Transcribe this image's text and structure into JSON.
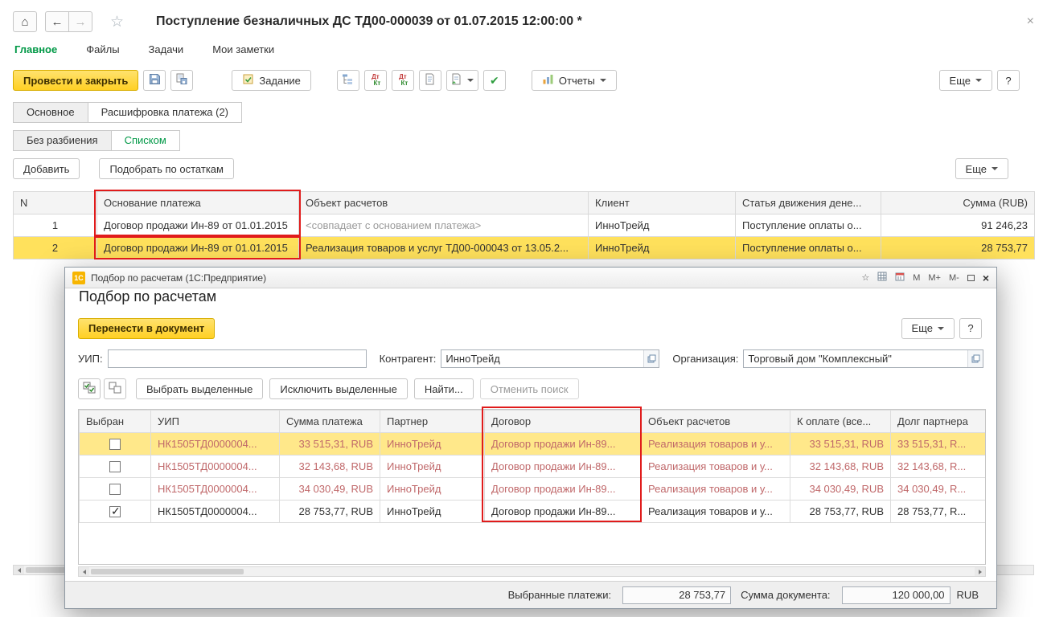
{
  "icons": {
    "home": "⌂",
    "back": "←",
    "forward": "→",
    "favorite": "☆",
    "close": "×",
    "post_check": "✔",
    "dt": "Дт",
    "kt": "Кт",
    "logo_1c": "1С"
  },
  "window": {
    "title": "Поступление безналичных ДС ТД00-000039 от 01.07.2015 12:00:00 *"
  },
  "menu": {
    "items": [
      {
        "label": "Главное"
      },
      {
        "label": "Файлы"
      },
      {
        "label": "Задачи"
      },
      {
        "label": "Мои заметки"
      }
    ]
  },
  "toolbar": {
    "post_and_close": "Провести и закрыть",
    "task": "Задание",
    "reports": "Отчеты",
    "more": "Еще",
    "help": "?"
  },
  "doc_tabs": {
    "main": "Основное",
    "breakdown": "Расшифровка платежа (2)"
  },
  "view_tabs": {
    "no_split": "Без разбиения",
    "as_list": "Списком"
  },
  "list_toolbar": {
    "add": "Добавить",
    "pick_by_balances": "Подобрать по остаткам",
    "more": "Еще"
  },
  "payments_table": {
    "columns": [
      "N",
      "Основание платежа",
      "Объект расчетов",
      "Клиент",
      "Статья движения дене...",
      "Сумма (RUB)"
    ],
    "rows": [
      {
        "n": "1",
        "basis": "Договор продажи Ин-89 от 01.01.2015",
        "settlement_object": "<совпадает с основанием платежа>",
        "client": "ИнноТрейд",
        "cash_flow_item": "Поступление оплаты о...",
        "amount": "91 246,23"
      },
      {
        "n": "2",
        "basis": "Договор продажи Ин-89 от 01.01.2015",
        "settlement_object": "Реализация товаров и услуг ТД00-000043 от 13.05.2...",
        "client": "ИнноТрейд",
        "cash_flow_item": "Поступление оплаты о...",
        "amount": "28 753,77"
      }
    ]
  },
  "dialog": {
    "window_title": "Подбор по расчетам  (1С:Предприятие)",
    "window_buttons": {
      "m": "М",
      "m_plus": "М+",
      "m_minus": "М-"
    },
    "heading": "Подбор по расчетам",
    "transfer_button": "Перенести в документ",
    "more": "Еще",
    "help": "?",
    "form": {
      "uip_label": "УИП:",
      "uip_value": "",
      "counterparty_label": "Контрагент:",
      "counterparty_value": "ИнноТрейд",
      "organization_label": "Организация:",
      "organization_value": "Торговый дом \"Комплексный\""
    },
    "actions": {
      "select_highlighted": "Выбрать выделенные",
      "exclude_highlighted": "Исключить выделенные",
      "find": "Найти...",
      "cancel_search": "Отменить поиск"
    },
    "picker_table": {
      "columns": [
        "Выбран",
        "УИП",
        "Сумма платежа",
        "Партнер",
        "Договор",
        "Объект расчетов",
        "К оплате (все...",
        "Долг партнера"
      ],
      "rows": [
        {
          "checked": false,
          "uip": "НК1505ТД0000004...",
          "payment_amount": "33 515,31, RUB",
          "partner": "ИнноТрейд",
          "contract": "Договор продажи Ин-89...",
          "settlement_object": "Реализация товаров и у...",
          "to_pay": "33 515,31, RUB",
          "partner_debt": "33 515,31, R..."
        },
        {
          "checked": false,
          "uip": "НК1505ТД0000004...",
          "payment_amount": "32 143,68, RUB",
          "partner": "ИнноТрейд",
          "contract": "Договор продажи Ин-89...",
          "settlement_object": "Реализация товаров и у...",
          "to_pay": "32 143,68, RUB",
          "partner_debt": "32 143,68, R..."
        },
        {
          "checked": false,
          "uip": "НК1505ТД0000004...",
          "payment_amount": "34 030,49, RUB",
          "partner": "ИнноТрейд",
          "contract": "Договор продажи Ин-89...",
          "settlement_object": "Реализация товаров и у...",
          "to_pay": "34 030,49, RUB",
          "partner_debt": "34 030,49, R..."
        },
        {
          "checked": true,
          "uip": "НК1505ТД0000004...",
          "payment_amount": "28 753,77, RUB",
          "partner": "ИнноТрейд",
          "contract": "Договор продажи Ин-89...",
          "settlement_object": "Реализация товаров и у...",
          "to_pay": "28 753,77, RUB",
          "partner_debt": "28 753,77, R..."
        }
      ]
    },
    "footer": {
      "selected_payments_label": "Выбранные платежи:",
      "selected_payments_value": "28 753,77",
      "document_total_label": "Сумма документа:",
      "document_total_value": "120 000,00",
      "currency": "RUB"
    }
  },
  "colors": {
    "accent_yellow": "#FFD633",
    "brand_green": "#009846",
    "selected_row": "#FFE15C",
    "current_row": "#FFE88A",
    "overdue_text": "#C0686A",
    "highlight_border": "#E01B1B"
  }
}
